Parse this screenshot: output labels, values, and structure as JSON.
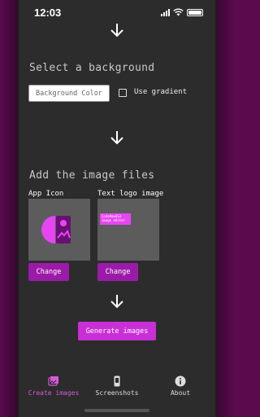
{
  "status": {
    "time": "12:03"
  },
  "sections": {
    "background": {
      "title": "Select a background",
      "input_placeholder": "Background Color",
      "use_gradient": "Use gradient"
    },
    "images": {
      "title": "Add the image files",
      "app_icon_label": "App Icon",
      "text_logo_label": "Text logo image",
      "text_logo_preview": "CodeHawGS3\nimage editor",
      "change_label": "Change"
    }
  },
  "generate_label": "Generate images",
  "tabs": [
    {
      "label": "Create images",
      "icon": "images-icon",
      "active": true
    },
    {
      "label": "Screenshots",
      "icon": "phone-screenshot-icon",
      "active": false
    },
    {
      "label": "About",
      "icon": "info-icon",
      "active": false
    }
  ],
  "colors": {
    "accent": "#c92fd6",
    "button": "#9b1ba8",
    "background": "#2c2c2c"
  }
}
